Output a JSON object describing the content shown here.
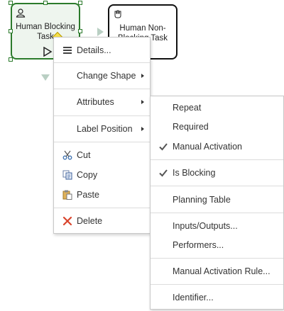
{
  "canvas": {
    "task_blocking": {
      "label": "Human Blocking Task"
    },
    "task_nonblocking": {
      "label": "Human Non-Blocking Task"
    }
  },
  "context_menu": {
    "details": "Details...",
    "change_shape": "Change Shape",
    "attributes": "Attributes",
    "label_position": "Label Position",
    "cut": "Cut",
    "copy": "Copy",
    "paste": "Paste",
    "delete": "Delete"
  },
  "attributes_submenu": {
    "repeat": "Repeat",
    "required": "Required",
    "manual_activation": "Manual Activation",
    "is_blocking": "Is Blocking",
    "planning_table": "Planning Table",
    "inputs_outputs": "Inputs/Outputs...",
    "performers": "Performers...",
    "manual_activation_rule": "Manual Activation Rule...",
    "identifier": "Identifier..."
  },
  "colors": {
    "selection_border": "#2b7a2b",
    "delete_icon": "#d9442c",
    "cut_icon": "#3a6fb0"
  }
}
